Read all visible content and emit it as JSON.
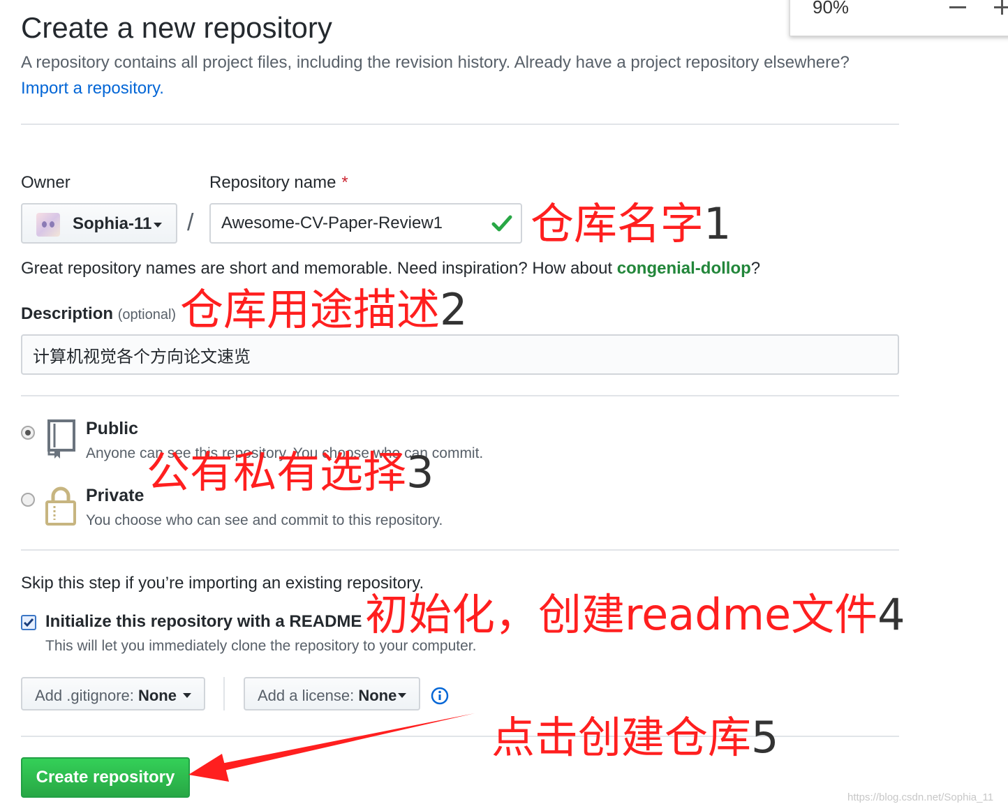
{
  "zoom": {
    "value": "90%",
    "minus_icon": "minus-icon",
    "plus_icon": "plus-icon"
  },
  "header": {
    "title": "Create a new repository",
    "intro": "A repository contains all project files, including the revision history. Already have a project repository elsewhere?",
    "import_link": "Import a repository."
  },
  "owner": {
    "label": "Owner",
    "name": "Sophia-11"
  },
  "repository": {
    "label": "Repository name",
    "required_mark": "*",
    "separator": "/",
    "value": "Awesome-CV-Paper-Review1"
  },
  "hint": {
    "prefix": "Great repository names are short and memorable. Need inspiration? How about ",
    "suggestion": "congenial-dollop",
    "suffix": "?"
  },
  "description": {
    "label": "Description",
    "optional": "(optional)",
    "value": "计算机视觉各个方向论文速览"
  },
  "visibility": {
    "public": {
      "title": "Public",
      "desc": "Anyone can see this repository. You choose who can commit.",
      "checked": true
    },
    "private": {
      "title": "Private",
      "desc": "You choose who can see and commit to this repository.",
      "checked": false
    }
  },
  "init": {
    "skip_text": "Skip this step if you’re importing an existing repository.",
    "readme_label": "Initialize this repository with a README",
    "readme_desc": "This will let you immediately clone the repository to your computer.",
    "readme_checked": true
  },
  "selects": {
    "gitignore": {
      "prefix": "Add .gitignore: ",
      "value": "None"
    },
    "license": {
      "prefix": "Add a license: ",
      "value": "None"
    }
  },
  "submit": {
    "label": "Create repository"
  },
  "annotations": {
    "a1": {
      "text": "仓库名字",
      "num": "1"
    },
    "a2": {
      "text": "仓库用途描述",
      "num": "2"
    },
    "a3": {
      "text": "公有私有选择",
      "num": "3"
    },
    "a4": {
      "text": "初始化，创建readme文件",
      "num": "4"
    },
    "a5": {
      "text": "点击创建仓库",
      "num": "5"
    },
    "arrow_color": "#ff1f1f"
  },
  "watermark": "https://blog.csdn.net/Sophia_11"
}
